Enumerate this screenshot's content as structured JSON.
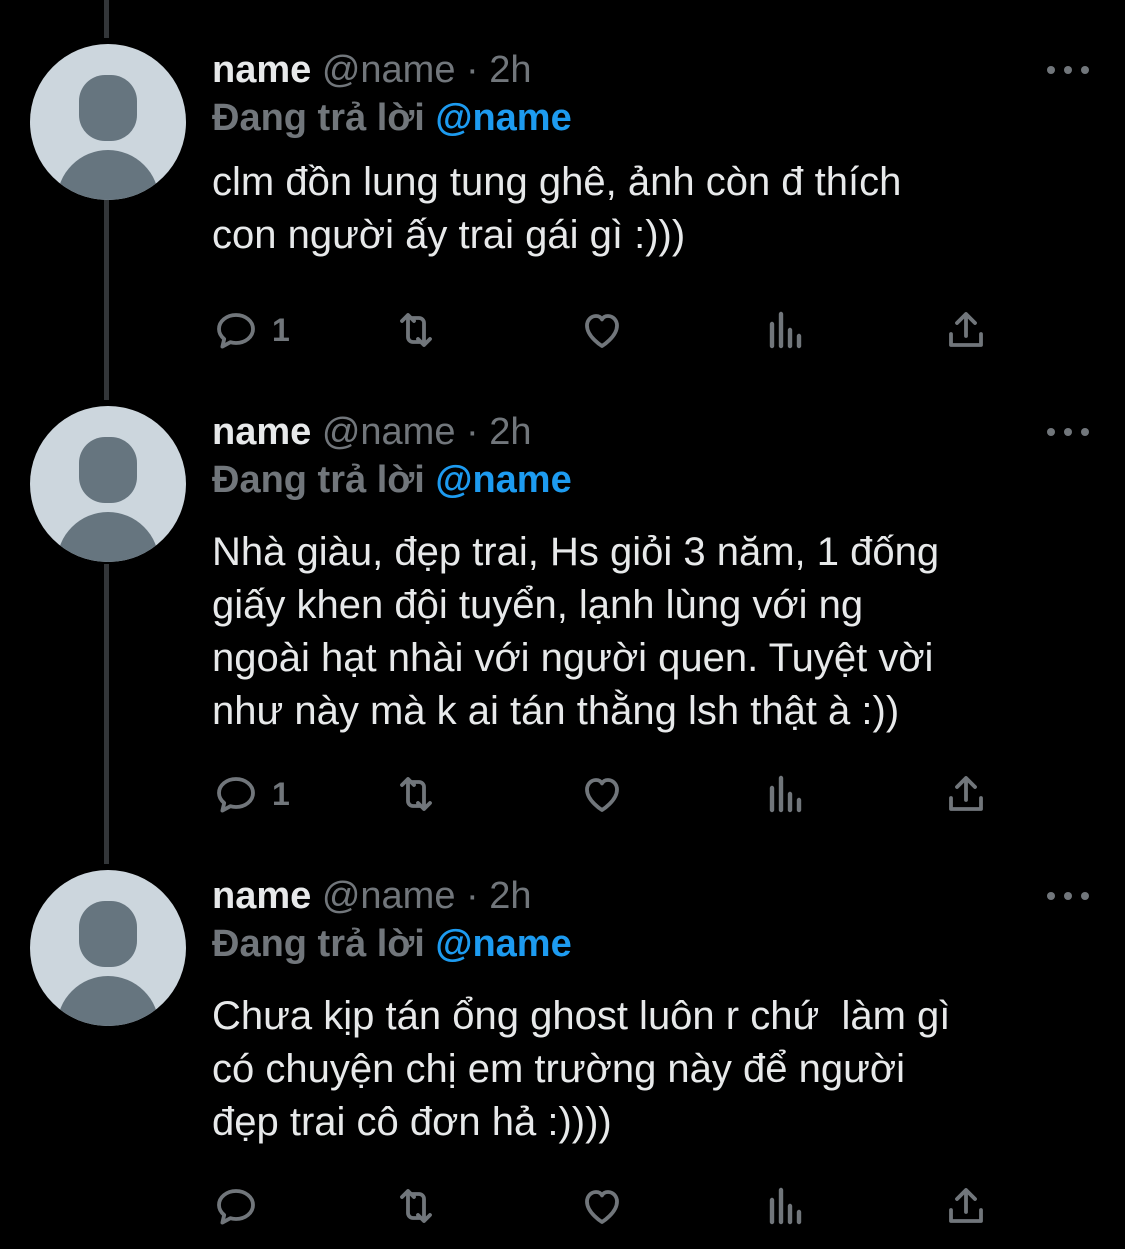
{
  "colors": {
    "background": "#000000",
    "text_primary": "#e7e9ea",
    "text_secondary": "#71767b",
    "accent": "#1d9bf0",
    "avatar_bg": "#ccd6dd",
    "avatar_fg": "#66757f",
    "thread_line": "#333639"
  },
  "icons": {
    "reply": "speech-bubble-icon",
    "retweet": "retweet-arrows-icon",
    "like": "heart-icon",
    "analytics": "bar-chart-icon",
    "share": "upload-share-icon",
    "more": "three-dots-icon",
    "avatar": "default-profile-icon"
  },
  "tweets": [
    {
      "display_name": "name",
      "handle": "@name",
      "separator": "·",
      "time": "2h",
      "replying_prefix": "Đang trả lời",
      "replying_to": "@name",
      "text": "clm đồn lung tung ghê, ảnh còn đ thích\ncon người ấy trai gái gì :)))",
      "reply_count": "1"
    },
    {
      "display_name": "name",
      "handle": "@name",
      "separator": "·",
      "time": "2h",
      "replying_prefix": "Đang trả lời",
      "replying_to": "@name",
      "text": "Nhà giàu, đẹp trai, Hs giỏi 3 năm, 1 đống\ngiấy khen đội tuyển, lạnh lùng với ng\nngoài hạt nhài với người quen. Tuyệt vời\nnhư này mà k ai tán thằng lsh thật à :))",
      "reply_count": "1"
    },
    {
      "display_name": "name",
      "handle": "@name",
      "separator": "·",
      "time": "2h",
      "replying_prefix": "Đang trả lời",
      "replying_to": "@name",
      "text": "Chưa kịp tán ổng ghost luôn r chứ  làm gì\ncó chuyện chị em trường này để người\nđẹp trai cô đơn hả :))))",
      "reply_count": ""
    }
  ]
}
